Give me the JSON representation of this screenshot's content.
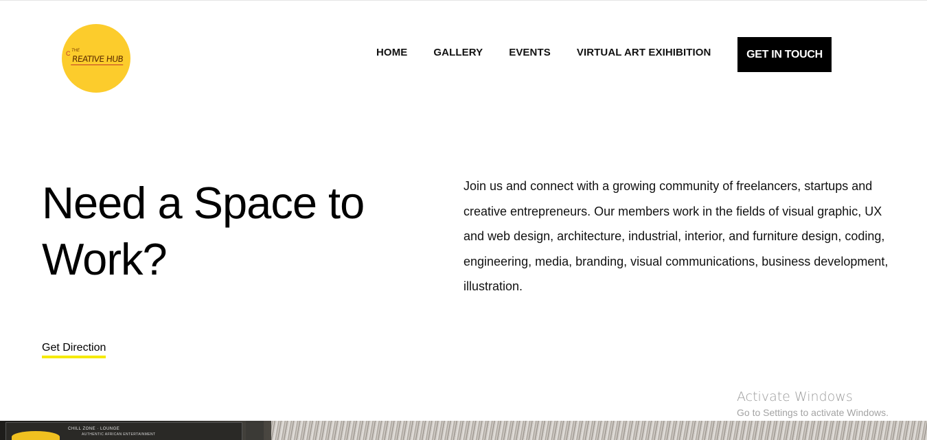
{
  "logo": {
    "small_text": "THE",
    "text": "REATIVE HUB",
    "bulb": "C",
    "color": "#fccc2c"
  },
  "nav": {
    "items": [
      {
        "label": "HOME"
      },
      {
        "label": "GALLERY"
      },
      {
        "label": "EVENTS"
      },
      {
        "label": "VIRTUAL ART EXIHIBITION"
      }
    ],
    "cta_label": "GET IN TOUCH"
  },
  "hero": {
    "headline_line1": "Need a Space to",
    "headline_line2": "Work?",
    "intro": "Join us and connect with a growing community of freelancers, startups and creative entrepreneurs. Our members work in the fields of visual graphic, UX and web design, architecture, industrial, interior, and furniture design, coding, engineering, media, branding, visual communications, business development, illustration.",
    "link_label": "Get Direction",
    "link_underline_color": "#f5ea00"
  },
  "watermark": {
    "title": "Activate Windows",
    "subtitle": "Go to Settings to activate Windows."
  },
  "photo": {
    "sign_text": "AUTHENTIC AFRICAN ENTERTAINMENT",
    "sign_text_2": "CHILL ZONE · LOUNGE"
  }
}
